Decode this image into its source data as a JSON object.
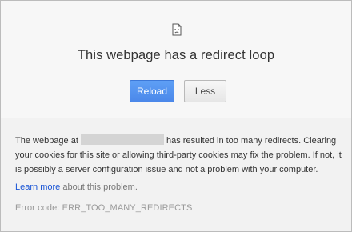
{
  "error_page": {
    "title": "This webpage has a redirect loop",
    "icon": "sad-page-icon",
    "buttons": {
      "reload_label": "Reload",
      "less_label": "Less"
    },
    "details": {
      "part_before_url": "The webpage at",
      "part_after_url": "has resulted in too many redirects. Clearing your cookies for this site or allowing third-party cookies may fix the problem. If not, it is possibly a server configuration issue and not a problem with your computer.",
      "learn_more_link": "Learn more",
      "learn_more_suffix": "about this problem.",
      "error_code": "Error code: ERR_TOO_MANY_REDIRECTS"
    }
  },
  "colors": {
    "top_bg": "#f7f7f7",
    "bottom_bg": "#f2f2f2",
    "primary_button": "#4d8ef0",
    "link": "#1a55d6",
    "error_code_text": "#9a9a9a"
  }
}
